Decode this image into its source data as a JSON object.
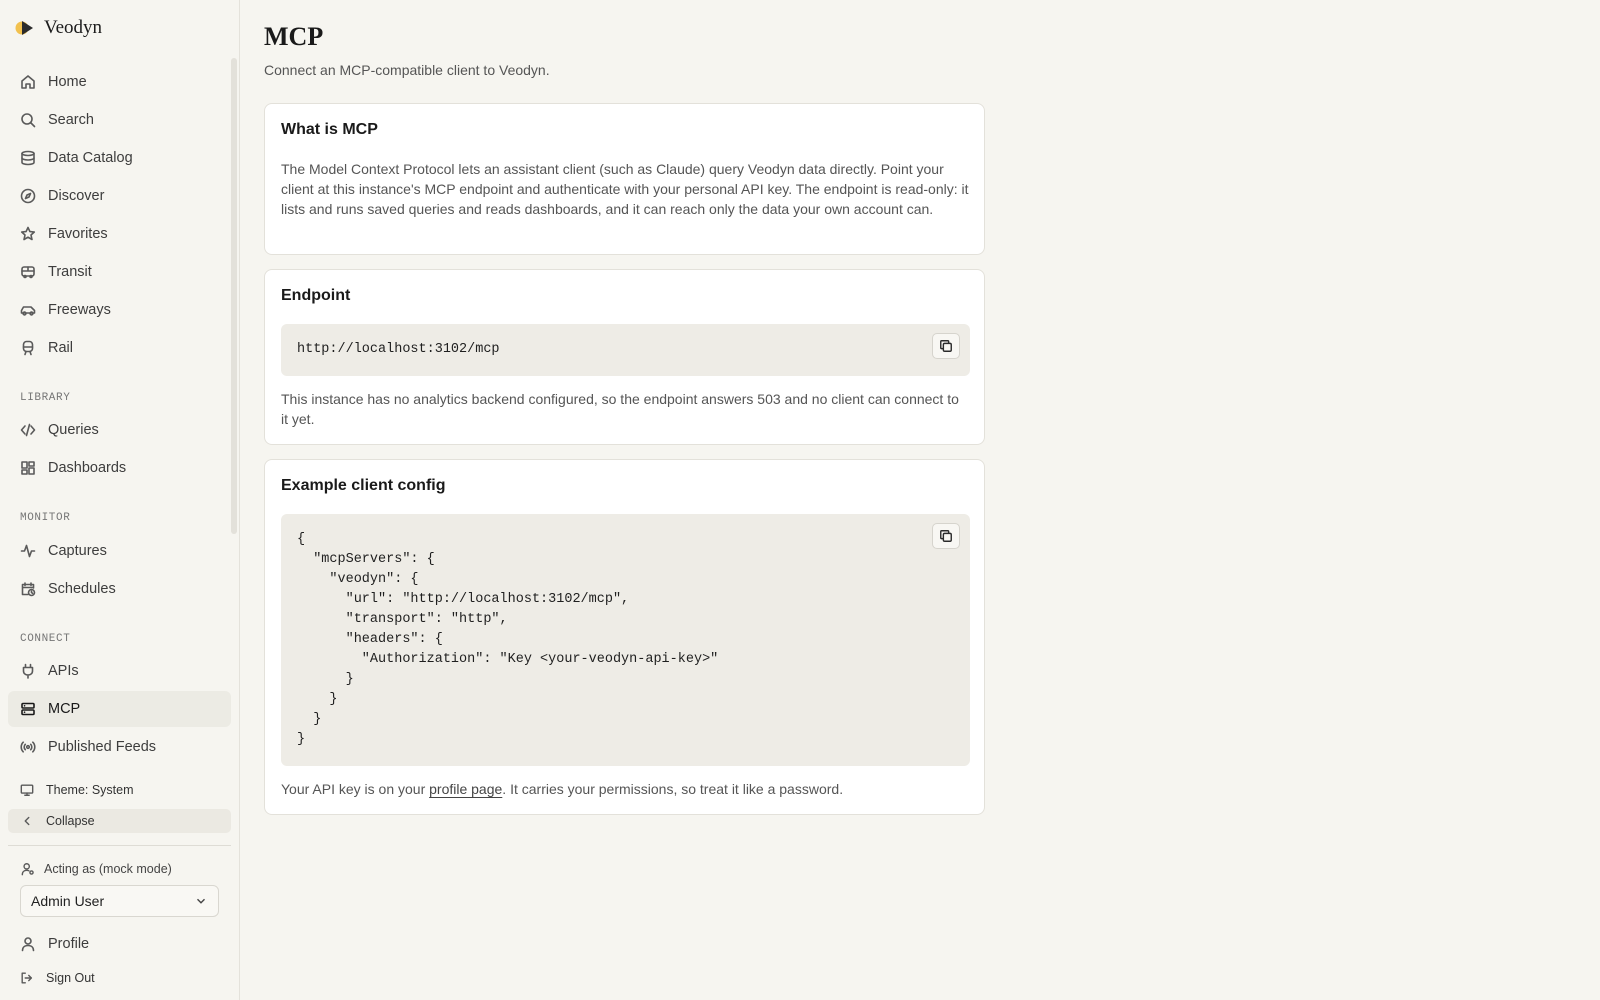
{
  "app": {
    "name": "Veodyn"
  },
  "sidebar": {
    "main_items": [
      {
        "label": "Home",
        "icon": "home-icon"
      },
      {
        "label": "Search",
        "icon": "search-icon"
      },
      {
        "label": "Data Catalog",
        "icon": "database-icon"
      },
      {
        "label": "Discover",
        "icon": "compass-icon"
      },
      {
        "label": "Favorites",
        "icon": "star-icon"
      },
      {
        "label": "Transit",
        "icon": "bus-icon"
      },
      {
        "label": "Freeways",
        "icon": "car-icon"
      },
      {
        "label": "Rail",
        "icon": "train-icon"
      }
    ],
    "library_label": "LIBRARY",
    "library_items": [
      {
        "label": "Queries",
        "icon": "code-icon"
      },
      {
        "label": "Dashboards",
        "icon": "dashboard-icon"
      }
    ],
    "monitor_label": "MONITOR",
    "monitor_items": [
      {
        "label": "Captures",
        "icon": "activity-icon"
      },
      {
        "label": "Schedules",
        "icon": "calendar-clock-icon"
      }
    ],
    "connect_label": "CONNECT",
    "connect_items": [
      {
        "label": "APIs",
        "icon": "plug-icon"
      },
      {
        "label": "MCP",
        "icon": "server-icon",
        "active": true
      },
      {
        "label": "Published Feeds",
        "icon": "broadcast-icon"
      }
    ],
    "theme_label": "Theme: System",
    "collapse_label": "Collapse",
    "acting_label": "Acting as (mock mode)",
    "acting_user": "Admin User",
    "profile_label": "Profile",
    "signout_label": "Sign Out"
  },
  "main": {
    "title": "MCP",
    "subtitle": "Connect an MCP-compatible client to Veodyn.",
    "what_is": {
      "title": "What is MCP",
      "body": "The Model Context Protocol lets an assistant client (such as Claude) query Veodyn data directly. Point your client at this instance's MCP endpoint and authenticate with your personal API key. The endpoint is read-only: it lists and runs saved queries and reads dashboards, and it can reach only the data your own account can."
    },
    "endpoint": {
      "title": "Endpoint",
      "url": "http://localhost:3102/mcp",
      "note": "This instance has no analytics backend configured, so the endpoint answers 503 and no client can connect to it yet."
    },
    "example": {
      "title": "Example client config",
      "code": "{\n  \"mcpServers\": {\n    \"veodyn\": {\n      \"url\": \"http://localhost:3102/mcp\",\n      \"transport\": \"http\",\n      \"headers\": {\n        \"Authorization\": \"Key <your-veodyn-api-key>\"\n      }\n    }\n  }\n}",
      "footer_prefix": "Your API key is on your ",
      "footer_link": "profile page",
      "footer_suffix": ". It carries your permissions, so treat it like a password."
    }
  },
  "colors": {
    "background": "#f6f5f0",
    "card": "#ffffff",
    "code_bg": "#eeece6",
    "active_nav": "#ecebe4"
  }
}
